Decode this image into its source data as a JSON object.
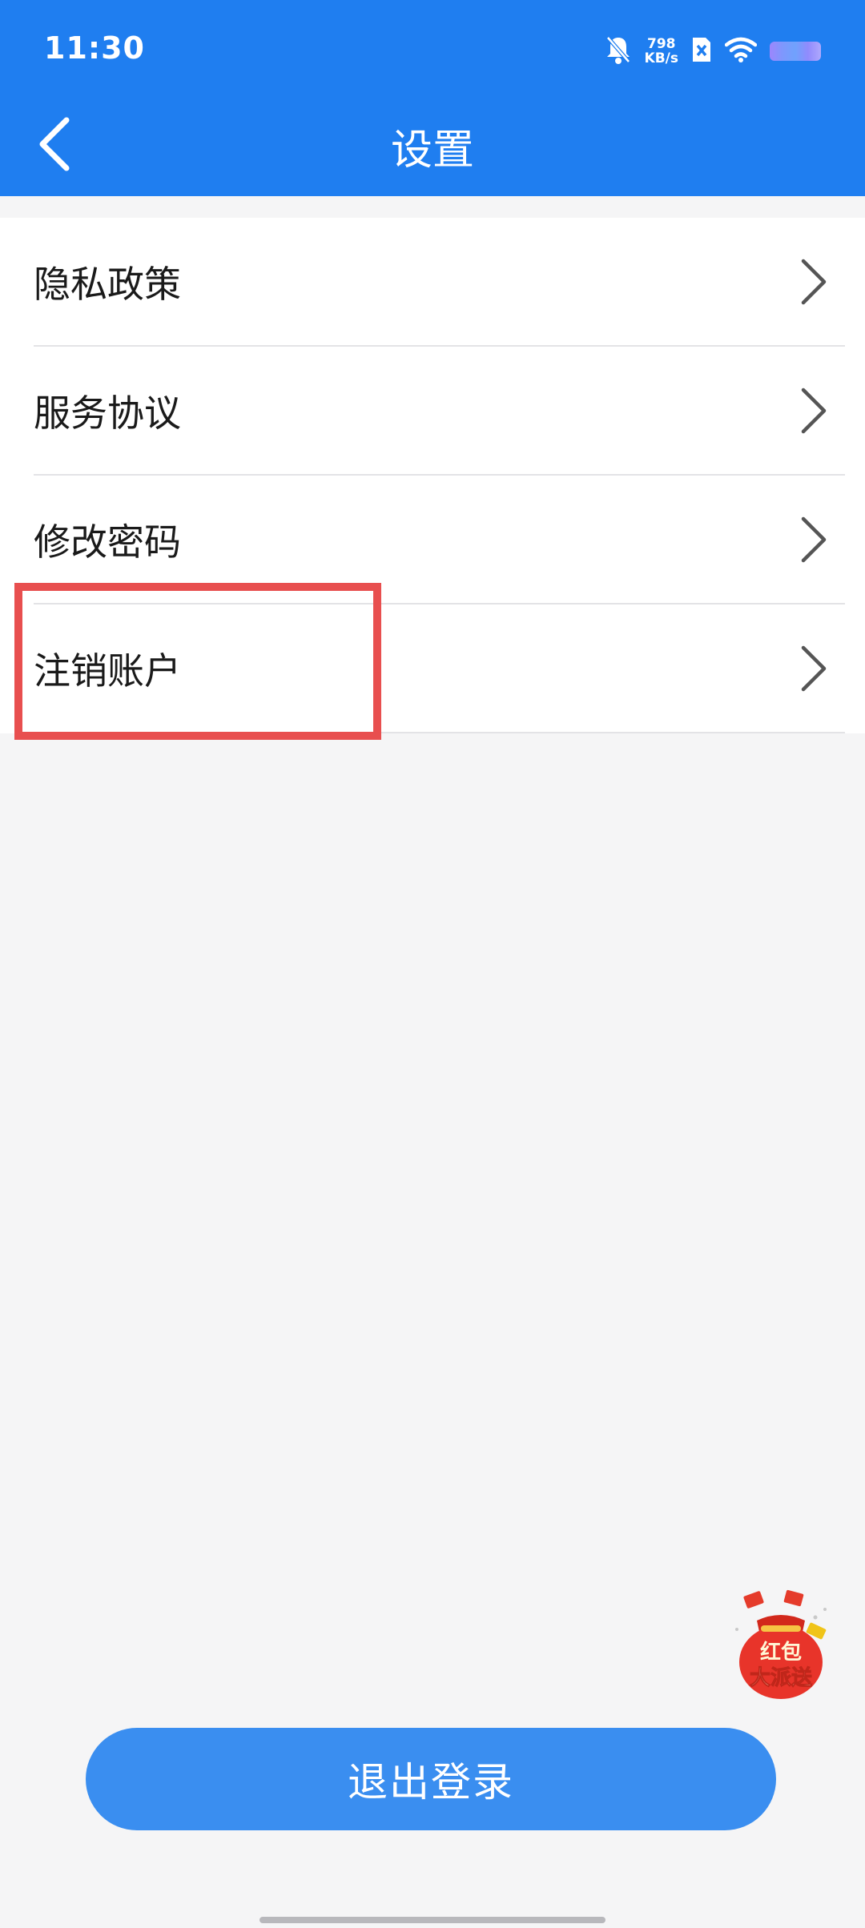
{
  "status_bar": {
    "time": "11:30",
    "net_speed_value": "798",
    "net_speed_unit": "KB/s",
    "icons": [
      "bell-muted-icon",
      "sim-disabled-icon",
      "wifi-icon",
      "battery-icon"
    ]
  },
  "nav": {
    "title": "设置",
    "back_icon": "chevron-left-icon"
  },
  "menu": {
    "items": [
      {
        "label": "隐私政策"
      },
      {
        "label": "服务协议"
      },
      {
        "label": "修改密码"
      },
      {
        "label": "注销账户"
      }
    ]
  },
  "floating_badge": {
    "line1": "红包",
    "line2": "大派送"
  },
  "logout_button": {
    "label": "退出登录"
  },
  "colors": {
    "header_bg": "#1f7ef0",
    "button_bg": "#3a8ef0",
    "highlight": "#e84f4f",
    "page_bg": "#f5f5f6"
  }
}
